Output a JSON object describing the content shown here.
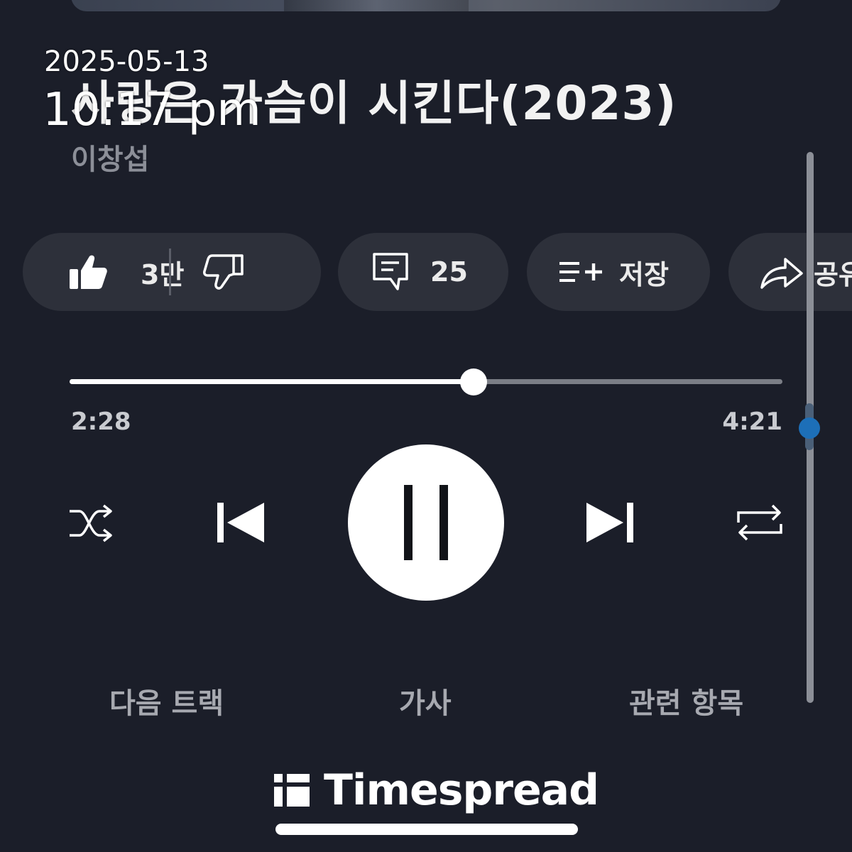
{
  "song": {
    "title": "사랑은 가슴이 시킨다(2023)",
    "artist": "이창섭"
  },
  "timestamp_overlay": {
    "date": "2025-05-13",
    "time": "10:17 pm"
  },
  "actions": {
    "like_count": "3만",
    "comment_count": "25",
    "save_label": "저장",
    "share_label": "공유"
  },
  "playback": {
    "elapsed": "2:28",
    "total": "4:21",
    "progress_fraction": 0.567,
    "state": "playing"
  },
  "tabs": {
    "up_next": "다음 트랙",
    "lyrics": "가사",
    "related": "관련 항목"
  },
  "brand": {
    "name": "Timespread"
  },
  "colors": {
    "background": "#1b1e29",
    "chip": "#2d303a",
    "accent_dot": "#1d6fb8"
  }
}
